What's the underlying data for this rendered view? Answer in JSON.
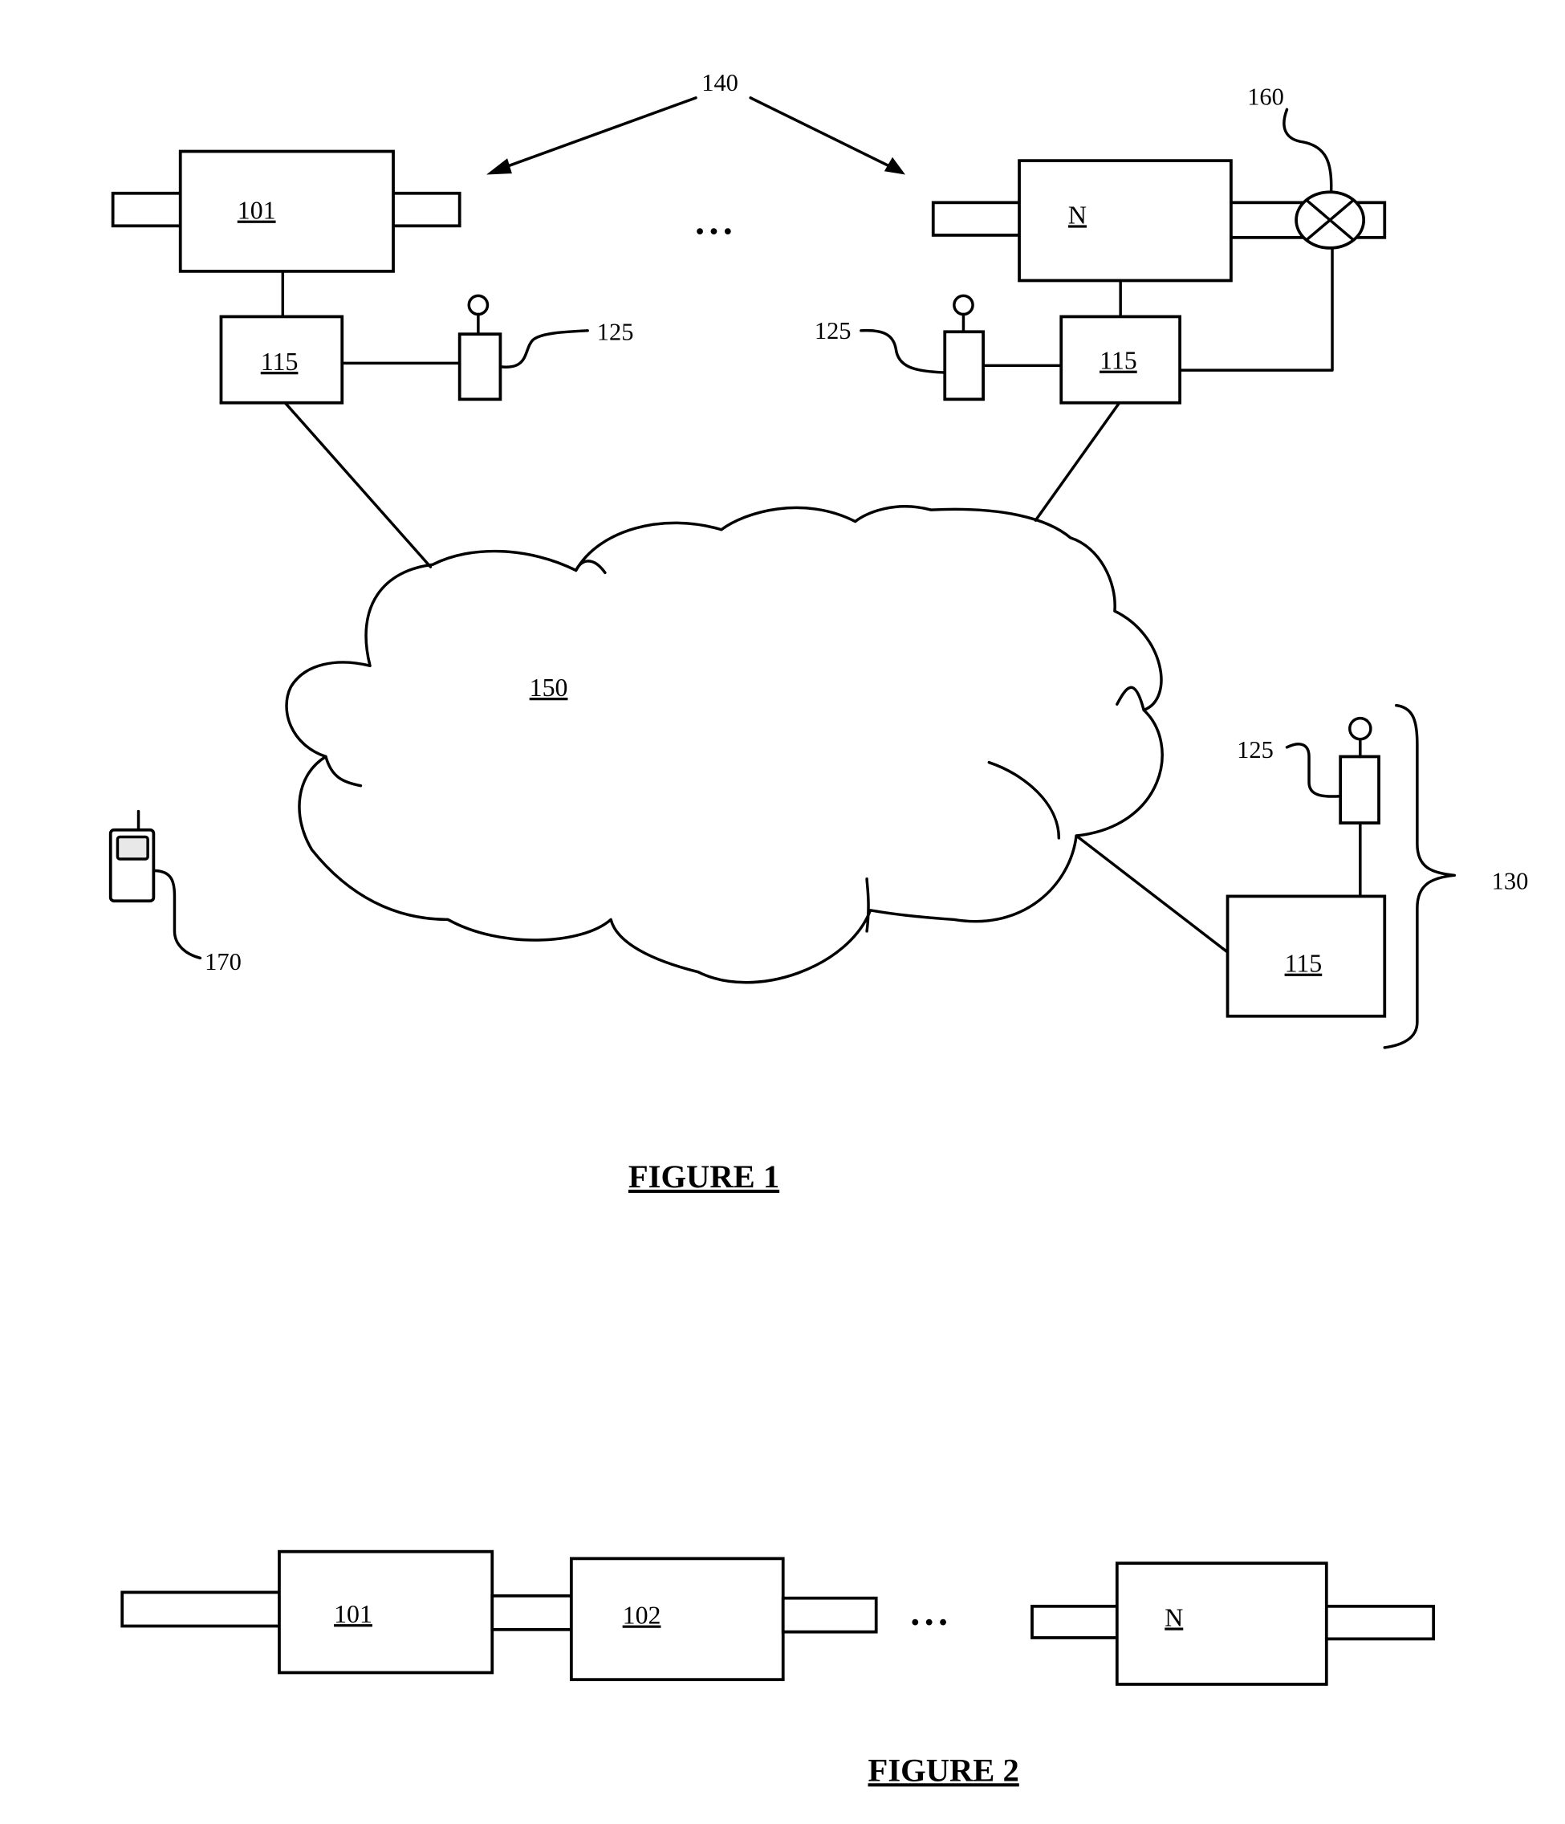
{
  "figure1": {
    "caption": "FIGURE 1",
    "group_label": "140",
    "ellipsis": "• • •",
    "segments": [
      {
        "label": "101",
        "controller_label": "115",
        "sensor_label": "125"
      },
      {
        "label": "N",
        "controller_label": "115",
        "sensor_label": "125",
        "valve_label": "160"
      }
    ],
    "network_label": "150",
    "remote_station": {
      "controller_label": "115",
      "sensor_label": "125",
      "group_label": "130"
    },
    "handheld_label": "170"
  },
  "figure2": {
    "caption": "FIGURE 2",
    "ellipsis": "• • •",
    "segments": [
      {
        "label": "101"
      },
      {
        "label": "102"
      },
      {
        "label": "N"
      }
    ]
  },
  "colors": {
    "ink": "#000000",
    "paper": "#ffffff"
  }
}
